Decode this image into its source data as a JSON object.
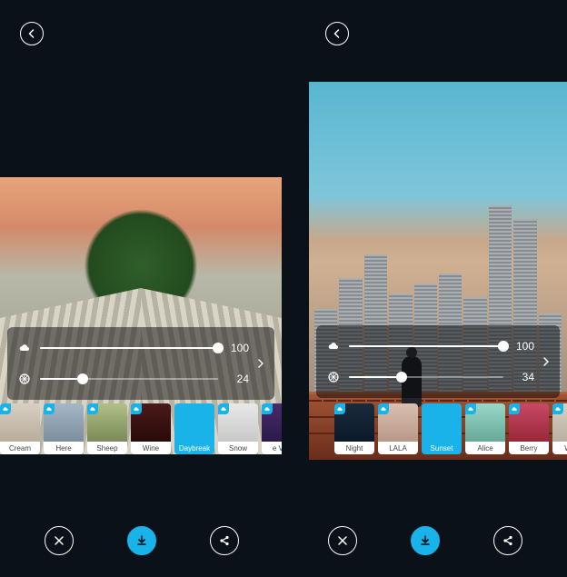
{
  "accent_color": "#19b3ea",
  "left_screen": {
    "slider1": {
      "value": 100,
      "percent": 100,
      "icon": "cloud"
    },
    "slider2": {
      "value": 24,
      "percent": 24,
      "icon": "aperture"
    },
    "filters": [
      {
        "label": "Cream",
        "swatch": "sw-cream",
        "cloud": true,
        "active": false
      },
      {
        "label": "Here",
        "swatch": "sw-here",
        "cloud": true,
        "active": false
      },
      {
        "label": "Sheep",
        "swatch": "sw-sheep",
        "cloud": true,
        "active": false
      },
      {
        "label": "Wine",
        "swatch": "sw-wine",
        "cloud": true,
        "active": false
      },
      {
        "label": "Daybreak",
        "swatch": "sw-daybreak",
        "cloud": false,
        "active": true
      },
      {
        "label": "Snow",
        "swatch": "sw-snow",
        "cloud": true,
        "active": false
      },
      {
        "label": "e Viet",
        "swatch": "sw-leviet",
        "cloud": true,
        "active": false
      }
    ]
  },
  "right_screen": {
    "slider1": {
      "value": 100,
      "percent": 100,
      "icon": "cloud"
    },
    "slider2": {
      "value": 34,
      "percent": 34,
      "icon": "aperture"
    },
    "filters": [
      {
        "label": "Night",
        "swatch": "sw-night",
        "cloud": true,
        "active": false
      },
      {
        "label": "LALA",
        "swatch": "sw-lala",
        "cloud": true,
        "active": false
      },
      {
        "label": "Sunset",
        "swatch": "sw-sunset",
        "cloud": false,
        "active": true
      },
      {
        "label": "Alice",
        "swatch": "sw-alice",
        "cloud": true,
        "active": false
      },
      {
        "label": "Berry",
        "swatch": "sw-berry",
        "cloud": true,
        "active": false
      },
      {
        "label": "Walk",
        "swatch": "sw-walk",
        "cloud": true,
        "active": false
      }
    ]
  }
}
